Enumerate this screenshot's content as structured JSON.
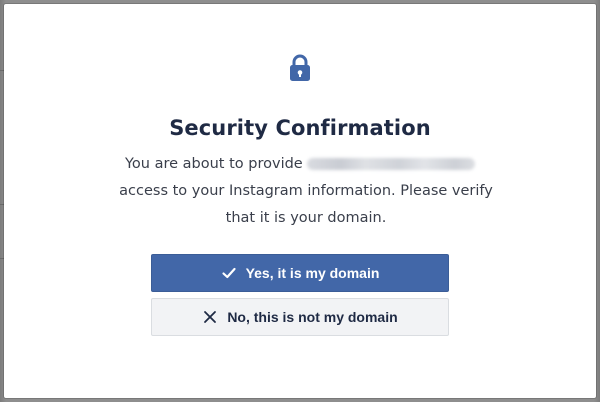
{
  "dialog": {
    "title": "Security Confirmation",
    "message": {
      "before_domain": "You are about to provide",
      "after_domain": "access to your Instagram information. Please verify that it is your domain."
    },
    "icon": "lock-icon"
  },
  "buttons": {
    "yes": {
      "label": "Yes, it is my domain",
      "icon": "checkmark-icon"
    },
    "no": {
      "label": "No, this is not my domain",
      "icon": "close-icon"
    }
  },
  "colors": {
    "primary": "#4267a8",
    "title": "#1f2a44",
    "secondary_button_bg": "#f2f3f5"
  }
}
